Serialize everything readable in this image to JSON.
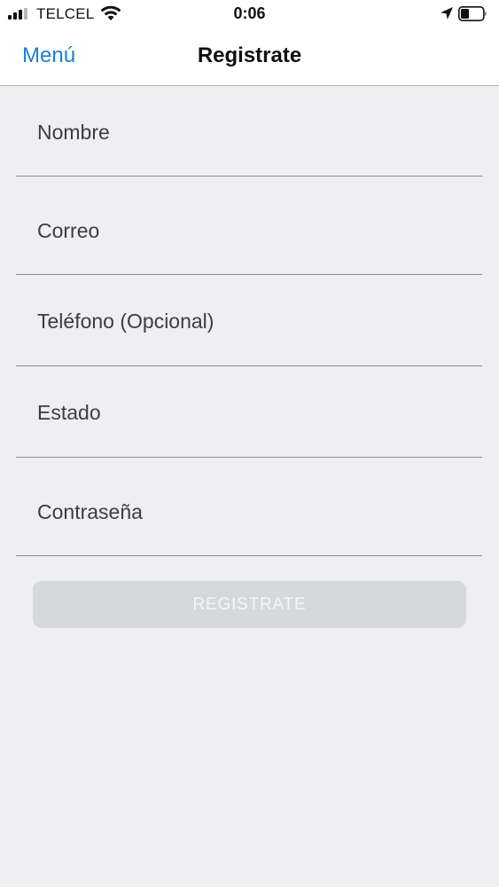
{
  "status_bar": {
    "carrier": "TELCEL",
    "time": "0:06",
    "signal_bars_filled": 3,
    "signal_bars_total": 4
  },
  "nav": {
    "back_label": "Menú",
    "title": "Registrate"
  },
  "form": {
    "fields": [
      {
        "placeholder": "Nombre",
        "value": ""
      },
      {
        "placeholder": "Correo",
        "value": ""
      },
      {
        "placeholder": "Teléfono (Opcional)",
        "value": ""
      },
      {
        "placeholder": "Estado",
        "value": ""
      },
      {
        "placeholder": "Contraseña",
        "value": ""
      }
    ],
    "submit_label": "REGISTRATE"
  },
  "colors": {
    "accent": "#1a7fd6",
    "background": "#efeef2",
    "button_disabled": "#d3dadb"
  }
}
